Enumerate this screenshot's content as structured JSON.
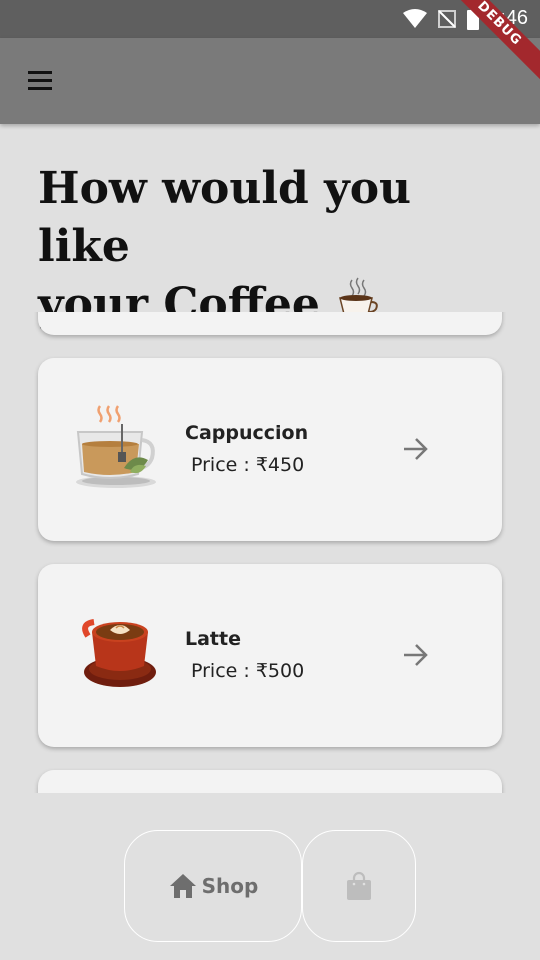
{
  "status_bar": {
    "time": "4:46"
  },
  "debug_banner": "DEBUG",
  "heading": {
    "line1": "How would you like",
    "line2": "your Coffee"
  },
  "products": [
    {
      "name": "Cappuccion",
      "price": "Price : ₹450",
      "icon": "cappuccino-icon"
    },
    {
      "name": "Latte",
      "price": "Price : ₹500",
      "icon": "latte-icon"
    }
  ],
  "bottom_nav": {
    "shop_label": "Shop",
    "shop_icon": "home-icon",
    "bag_icon": "shopping-bag-icon"
  },
  "colors": {
    "background": "#e0e0e0",
    "app_bar": "#7a7a7a",
    "status_bar": "#5f5f5f",
    "card": "#f3f3f3",
    "debug_ribbon": "#a3282d"
  }
}
